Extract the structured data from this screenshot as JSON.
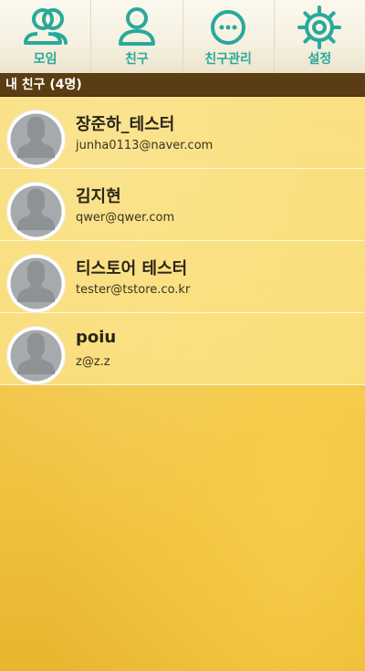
{
  "tabs": [
    {
      "label": "모임",
      "icon": "group-icon"
    },
    {
      "label": "친구",
      "icon": "person-icon"
    },
    {
      "label": "친구관리",
      "icon": "more-icon"
    },
    {
      "label": "설정",
      "icon": "gear-icon"
    }
  ],
  "colors": {
    "accent": "#2aa99b",
    "header_bg": "#5a3d12"
  },
  "section_header": "내 친구 (4명)",
  "friends": [
    {
      "name": "장준하_테스터",
      "email": "junha0113@naver.com"
    },
    {
      "name": "김지현",
      "email": "qwer@qwer.com"
    },
    {
      "name": "티스토어 테스터",
      "email": "tester@tstore.co.kr"
    },
    {
      "name": "poiu",
      "email": "z@z.z"
    }
  ]
}
